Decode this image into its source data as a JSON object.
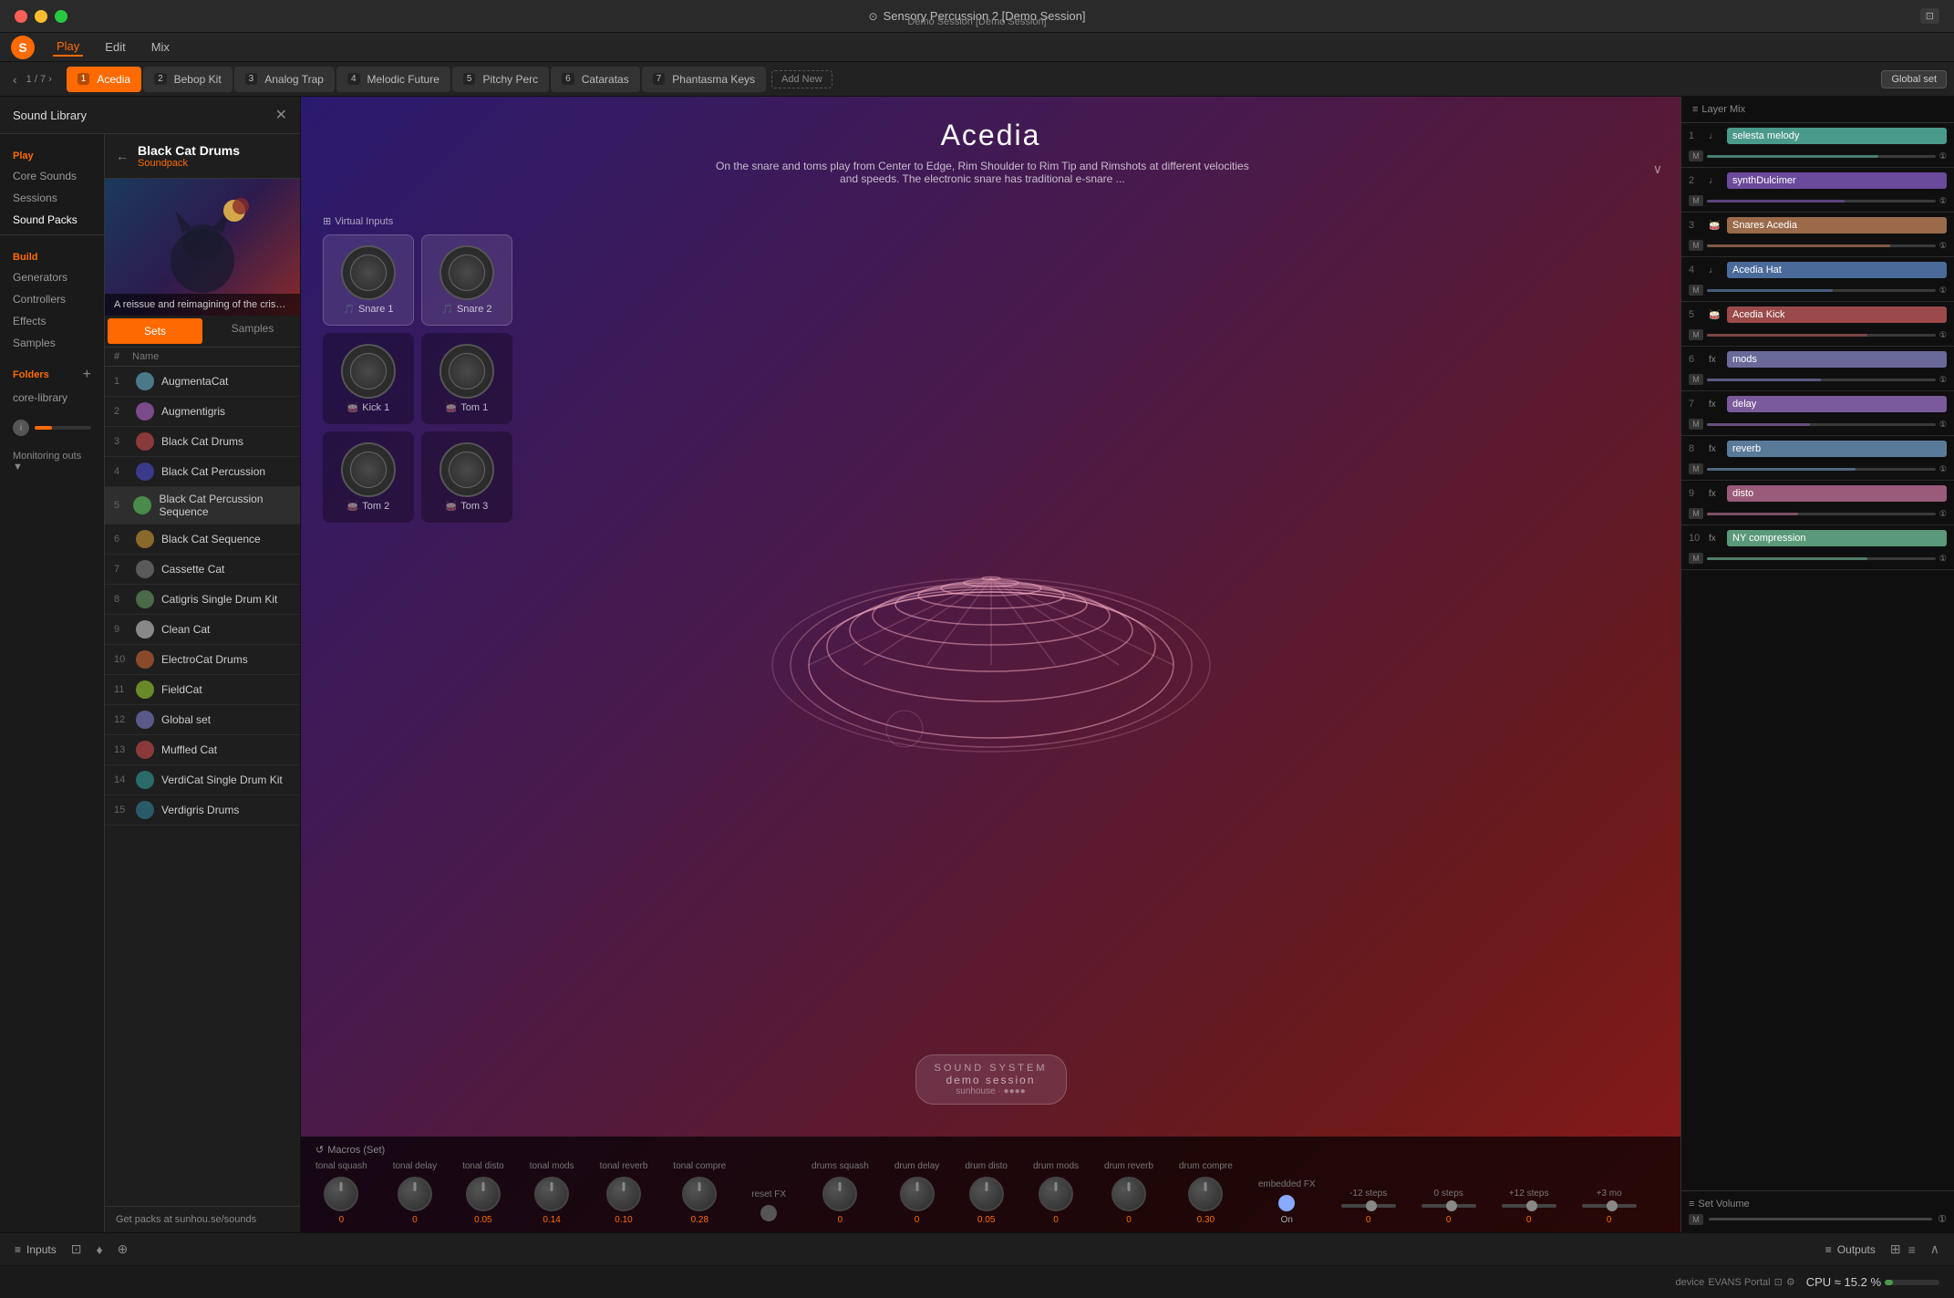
{
  "titleBar": {
    "title": "Sensory Percussion 2 [Demo Session]",
    "subtitle": "Demo Session [Demo Session]",
    "icon": "⊙"
  },
  "menuBar": {
    "items": [
      "Play",
      "Edit",
      "Mix"
    ],
    "activeItem": "Play"
  },
  "tabBar": {
    "navLeft": "‹",
    "navRight": "›",
    "pageNum": "1",
    "pageTotal": "7",
    "tabs": [
      {
        "label": "Acedia",
        "num": "1",
        "active": true
      },
      {
        "label": "Bebop Kit",
        "num": "2",
        "active": false
      },
      {
        "label": "Analog Trap",
        "num": "3",
        "active": false
      },
      {
        "label": "Melodic Future",
        "num": "4",
        "active": false
      },
      {
        "label": "Pitchy Perc",
        "num": "5",
        "active": false
      },
      {
        "label": "Cataratas",
        "num": "6",
        "active": false
      },
      {
        "label": "Phantasma Keys",
        "num": "7",
        "active": false
      }
    ],
    "addNew": "Add New",
    "globalSet": "Global set"
  },
  "soundLibrary": {
    "title": "Sound Library",
    "pack": {
      "name": "Black Cat Drums",
      "type": "Soundpack",
      "description": "A reissue and reimagining of the crisp, booming, classic dr"
    },
    "tabs": [
      "Sets",
      "Samples"
    ],
    "activeTab": "Sets",
    "columns": {
      "num": "#",
      "name": "Name"
    },
    "items": [
      {
        "name": "AugmentaCat",
        "color": "#4a7a8a"
      },
      {
        "name": "Augmentigris",
        "color": "#7a4a8a"
      },
      {
        "name": "Black Cat Drums",
        "color": "#8a3a3a"
      },
      {
        "name": "Black Cat Percussion",
        "color": "#3a3a8a"
      },
      {
        "name": "Black Cat Percussion Sequence",
        "color": "#4a8a4a",
        "active": true
      },
      {
        "name": "Black Cat Sequence",
        "color": "#8a6a2a"
      },
      {
        "name": "Cassette Cat",
        "color": "#5a5a5a"
      },
      {
        "name": "Catigris Single Drum Kit",
        "color": "#4a6a4a"
      },
      {
        "name": "Clean Cat",
        "color": "#888"
      },
      {
        "name": "ElectroCat Drums",
        "color": "#8a4a2a"
      },
      {
        "name": "FieldCat",
        "color": "#6a8a2a"
      },
      {
        "name": "Global set",
        "color": "#5a5a8a"
      },
      {
        "name": "Muffled Cat",
        "color": "#8a3a3a"
      },
      {
        "name": "VerdiCat Single Drum Kit",
        "color": "#2a6a6a"
      },
      {
        "name": "Verdigris Drums",
        "color": "#2a5a6a"
      }
    ],
    "footer": "Get packs at sunhou.se/sounds"
  },
  "sideNav": {
    "playSection": "Play",
    "playItems": [
      "Core Sounds",
      "Sessions",
      "Sound Packs"
    ],
    "activePlayItem": "Sound Packs",
    "buildSection": "Build",
    "buildItems": [
      "Generators",
      "Controllers",
      "Effects",
      "Samples"
    ],
    "foldersSection": "Folders",
    "folderItems": [
      "core-library"
    ]
  },
  "mainContent": {
    "title": "Acedia",
    "description": "On the snare and toms play from Center to Edge, Rim Shoulder to Rim Tip and Rimshots at different velocities and speeds. The electronic snare has traditional e-snare ...",
    "virtualInputsLabel": "Virtual Inputs",
    "virtualInputs": [
      {
        "label": "Snare 1",
        "icon": "🥁",
        "active": true
      },
      {
        "label": "Snare 2",
        "icon": "🥁",
        "active": true
      },
      {
        "label": "Kick 1",
        "icon": "🥁",
        "active": false
      },
      {
        "label": "Tom 1",
        "icon": "🥁",
        "active": false
      },
      {
        "label": "Tom 2",
        "icon": "🥁",
        "active": false
      },
      {
        "label": "Tom 3",
        "icon": "🥁",
        "active": false
      }
    ],
    "soundSystemBadge": {
      "line1": "SOUND SYSTEM",
      "line2": "demo session",
      "line3": "sunhouse · ●●●●"
    }
  },
  "macros": {
    "label": "Macros (Set)",
    "refresh": "↺",
    "knobs": [
      {
        "label": "tonal squash",
        "value": "0"
      },
      {
        "label": "tonal delay",
        "value": "0"
      },
      {
        "label": "tonal disto",
        "value": "0.05"
      },
      {
        "label": "tonal mods",
        "value": "0.14"
      },
      {
        "label": "tonal reverb",
        "value": "0.10"
      },
      {
        "label": "tonal compre",
        "value": "0.28"
      },
      {
        "label": "reset FX",
        "value": "",
        "isLed": true
      },
      {
        "label": "drums squash",
        "value": "0"
      },
      {
        "label": "drum delay",
        "value": "0"
      },
      {
        "label": "drum disto",
        "value": "0.05"
      },
      {
        "label": "drum mods",
        "value": "0"
      },
      {
        "label": "drum reverb",
        "value": "0"
      },
      {
        "label": "drum compre",
        "value": "0.30"
      },
      {
        "label": "embedded FX",
        "value": "On",
        "isLed": true
      },
      {
        "label": "-12 steps",
        "value": "",
        "isSlider": true
      },
      {
        "label": "0 steps",
        "value": "",
        "isSlider": true
      },
      {
        "label": "+12 steps",
        "value": "",
        "isSlider": true
      },
      {
        "label": "+3 mo",
        "value": "",
        "isSlider": true
      }
    ]
  },
  "layerMix": {
    "label": "Layer Mix",
    "layers": [
      {
        "num": "1",
        "icon": "♩",
        "name": "selesta melody",
        "color": "#4a9a8a",
        "fader": 75
      },
      {
        "num": "2",
        "icon": "♩",
        "name": "synthDulcimer",
        "color": "#6a4a9a",
        "fader": 60
      },
      {
        "num": "3",
        "icon": "🥁",
        "name": "Snares Acedia",
        "color": "#9a6a4a",
        "fader": 80
      },
      {
        "num": "4",
        "icon": "♩",
        "name": "Acedia Hat",
        "color": "#4a6a9a",
        "fader": 55
      },
      {
        "num": "5",
        "icon": "🥁",
        "name": "Acedia Kick",
        "color": "#9a4a4a",
        "fader": 70
      },
      {
        "num": "6",
        "icon": "fx",
        "name": "mods",
        "color": "#6a6a9a",
        "fader": 50
      },
      {
        "num": "7",
        "icon": "fx",
        "name": "delay",
        "color": "#7a5a9a",
        "fader": 45
      },
      {
        "num": "8",
        "icon": "fx",
        "name": "reverb",
        "color": "#5a7a9a",
        "fader": 65
      },
      {
        "num": "9",
        "icon": "fx",
        "name": "disto",
        "color": "#9a5a7a",
        "fader": 40
      },
      {
        "num": "10",
        "icon": "fx",
        "name": "NY compression",
        "color": "#5a9a7a",
        "fader": 70
      }
    ],
    "setVolumeLabel": "Set Volume"
  },
  "bottomBar": {
    "inputs": "Inputs",
    "outputs": "Outputs",
    "collapseIcon": "∧"
  },
  "statusBar": {
    "device": "EVANS Portal",
    "cpu": "CPU ≈ 15.2 %"
  },
  "monitoringOuts": "Monitoring outs"
}
